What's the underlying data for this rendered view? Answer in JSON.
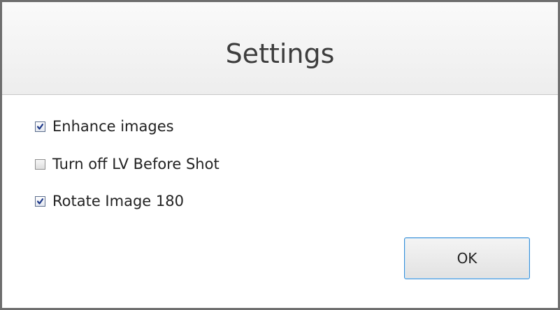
{
  "dialog": {
    "title": "Settings"
  },
  "options": [
    {
      "label": "Enhance images",
      "checked": true
    },
    {
      "label": "Turn off LV Before Shot",
      "checked": false
    },
    {
      "label": "Rotate Image 180",
      "checked": true
    }
  ],
  "buttons": {
    "ok_label": "OK"
  },
  "colors": {
    "border": "#6e6e6e",
    "header_bg": "#f2f2f2",
    "check_mark": "#1f3a8a",
    "focus_border": "#3a8fd6"
  },
  "icons": {
    "check": "checkmark-icon"
  }
}
